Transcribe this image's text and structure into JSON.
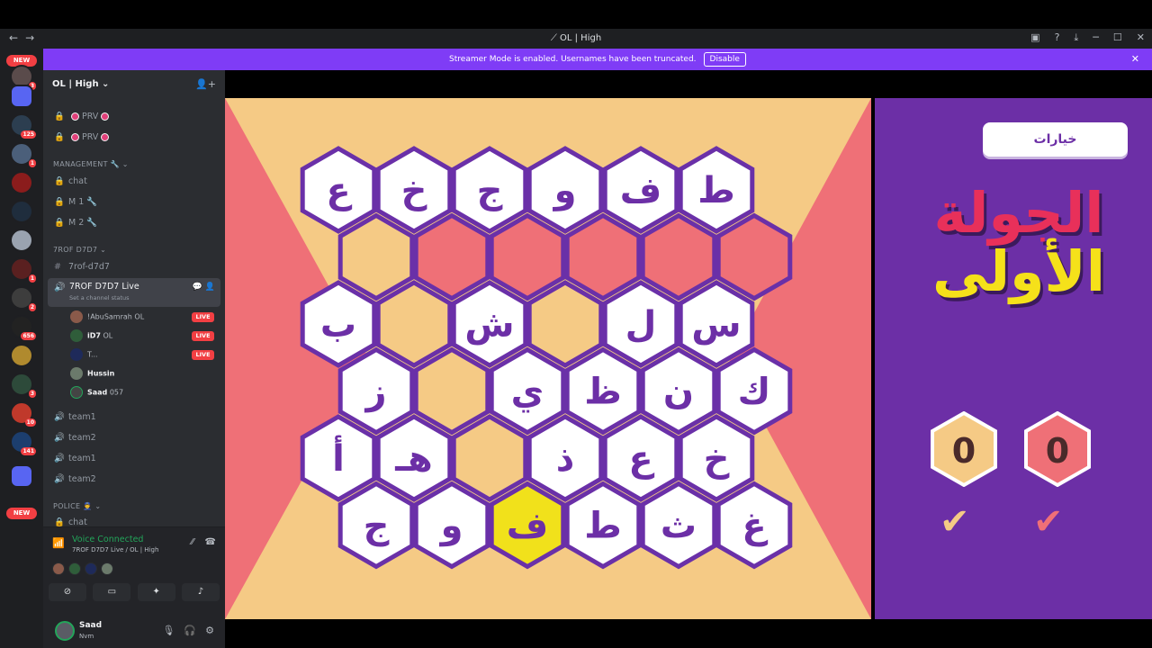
{
  "window": {
    "title": "OL | High"
  },
  "banner": {
    "text": "Streamer Mode is enabled. Usernames have been truncated.",
    "disable_label": "Disable"
  },
  "servers": {
    "new_label": "NEW",
    "badges": [
      "3",
      "125",
      "1",
      "1",
      "2",
      "656",
      "3",
      "10",
      "141"
    ]
  },
  "sidebar": {
    "server_name": "OL | High",
    "prv_channels": [
      "PRV",
      "PRV"
    ],
    "categories": {
      "management": "MANAGEMENT 🔧",
      "trof": "7ROF D7D7",
      "police": "POLICE 👮"
    },
    "management_channels": [
      "chat",
      "M 1 🔧",
      "M 2 🔧"
    ],
    "text_channel": "7rof-d7d7",
    "voice_channel": {
      "name": "7ROF D7D7 Live",
      "status": "Set a channel status"
    },
    "voice_users": [
      {
        "name": "!AbuSamrah",
        "tag": "OL",
        "live": "LIVE"
      },
      {
        "name": "iD7",
        "tag": "OL",
        "live": "LIVE"
      },
      {
        "name": "T...",
        "tag": "",
        "live": "LIVE"
      },
      {
        "name": "Hussin",
        "tag": "",
        "live": ""
      },
      {
        "name": "Saad",
        "tag": "057",
        "live": ""
      }
    ],
    "team_channels": [
      "team1",
      "team2",
      "team1",
      "team2"
    ],
    "police_channel": "chat"
  },
  "voice_panel": {
    "status": "Voice Connected",
    "location": "7ROF D7D7 Live / OL | High"
  },
  "user": {
    "name": "Saad",
    "status": "Nvm"
  },
  "game": {
    "options_label": "خيارات",
    "round_line1": "الجولة",
    "round_line2": "الأولى",
    "score_left": "0",
    "score_right": "0",
    "colors": {
      "orange": "#f5ca85",
      "pink": "#ef7077",
      "purple": "#6c2fa6",
      "yellow": "#f1e11b",
      "hex_border": "#6a30a8"
    },
    "rows": [
      {
        "offset": 0,
        "cells": [
          {
            "letter": "ع",
            "state": "white"
          },
          {
            "letter": "خ",
            "state": "white"
          },
          {
            "letter": "ج",
            "state": "white"
          },
          {
            "letter": "و",
            "state": "white"
          },
          {
            "letter": "ف",
            "state": "white"
          },
          {
            "letter": "ط",
            "state": "white"
          }
        ]
      },
      {
        "offset": 1,
        "cells": [
          {
            "letter": "",
            "state": "orange"
          },
          {
            "letter": "",
            "state": "pink"
          },
          {
            "letter": "",
            "state": "pink"
          },
          {
            "letter": "",
            "state": "pink"
          },
          {
            "letter": "",
            "state": "pink"
          },
          {
            "letter": "",
            "state": "pink"
          }
        ]
      },
      {
        "offset": 0,
        "cells": [
          {
            "letter": "ب",
            "state": "white"
          },
          {
            "letter": "",
            "state": "orange"
          },
          {
            "letter": "ش",
            "state": "white"
          },
          {
            "letter": "",
            "state": "orange"
          },
          {
            "letter": "ل",
            "state": "white"
          },
          {
            "letter": "س",
            "state": "white"
          }
        ]
      },
      {
        "offset": 1,
        "cells": [
          {
            "letter": "ز",
            "state": "white"
          },
          {
            "letter": "",
            "state": "orange"
          },
          {
            "letter": "ي",
            "state": "white"
          },
          {
            "letter": "ظ",
            "state": "white"
          },
          {
            "letter": "ن",
            "state": "white"
          },
          {
            "letter": "ك",
            "state": "white"
          }
        ]
      },
      {
        "offset": 0,
        "cells": [
          {
            "letter": "أ",
            "state": "white"
          },
          {
            "letter": "هـ",
            "state": "white"
          },
          {
            "letter": "",
            "state": "orange"
          },
          {
            "letter": "ذ",
            "state": "white"
          },
          {
            "letter": "ع",
            "state": "white"
          },
          {
            "letter": "خ",
            "state": "white"
          }
        ]
      },
      {
        "offset": 1,
        "cells": [
          {
            "letter": "ج",
            "state": "white"
          },
          {
            "letter": "و",
            "state": "white"
          },
          {
            "letter": "ف",
            "state": "yellow"
          },
          {
            "letter": "ط",
            "state": "white"
          },
          {
            "letter": "ث",
            "state": "white"
          },
          {
            "letter": "غ",
            "state": "white"
          }
        ]
      }
    ]
  }
}
